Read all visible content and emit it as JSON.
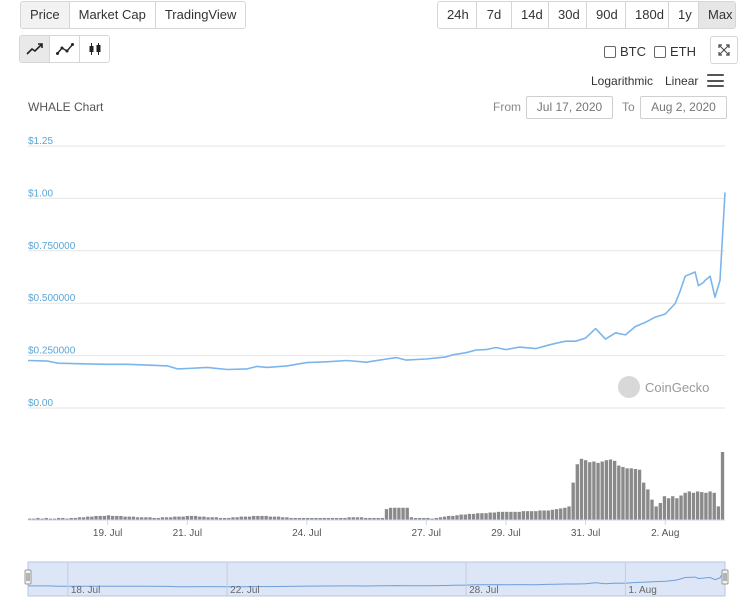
{
  "tabs": [
    "Price",
    "Market Cap",
    "TradingView"
  ],
  "active_tab": 0,
  "ranges": [
    "24h",
    "7d",
    "14d",
    "30d",
    "90d",
    "180d",
    "1y",
    "Max"
  ],
  "active_range": 7,
  "chart_types": [
    "line-chart-icon",
    "line-markers-chart-icon",
    "candlestick-chart-icon"
  ],
  "compare": {
    "btc": "BTC",
    "eth": "ETH"
  },
  "scale": {
    "log": "Logarithmic",
    "linear": "Linear"
  },
  "chart_title": "WHALE Chart",
  "range_inputs": {
    "from_label": "From",
    "from_value": "Jul 17, 2020",
    "to_label": "To",
    "to_value": "Aug 2, 2020"
  },
  "watermark": "CoinGecko",
  "colors": {
    "price_line": "#7cb5ec",
    "volume_bar": "#8a8a8a",
    "axis_text": "#5aa6d6",
    "navigator_fill": "#cfdcf2"
  },
  "chart_data": {
    "type": "line",
    "y_ticks": [
      "$0.00",
      "$0.250000",
      "$0.500000",
      "$0.750000",
      "$1.00",
      "$1.25"
    ],
    "ylim": [
      0,
      1.25
    ],
    "x_ticks": [
      "19. Jul",
      "21. Jul",
      "24. Jul",
      "27. Jul",
      "29. Jul",
      "31. Jul",
      "2. Aug"
    ],
    "navigator_ticks": [
      "18. Jul",
      "22. Jul",
      "28. Jul",
      "1. Aug"
    ],
    "price": [
      [
        "2020-07-17 00:00",
        0.198
      ],
      [
        "2020-07-17 12:00",
        0.195
      ],
      [
        "2020-07-17 18:00",
        0.185
      ],
      [
        "2020-07-18 12:00",
        0.182
      ],
      [
        "2020-07-19 00:00",
        0.18
      ],
      [
        "2020-07-19 12:00",
        0.18
      ],
      [
        "2020-07-20 00:00",
        0.176
      ],
      [
        "2020-07-20 12:00",
        0.172
      ],
      [
        "2020-07-20 18:00",
        0.158
      ],
      [
        "2020-07-21 00:00",
        0.16
      ],
      [
        "2020-07-21 12:00",
        0.165
      ],
      [
        "2020-07-22 00:00",
        0.155
      ],
      [
        "2020-07-22 12:00",
        0.158
      ],
      [
        "2020-07-22 18:00",
        0.17
      ],
      [
        "2020-07-23 00:00",
        0.165
      ],
      [
        "2020-07-23 12:00",
        0.172
      ],
      [
        "2020-07-24 00:00",
        0.188
      ],
      [
        "2020-07-24 12:00",
        0.192
      ],
      [
        "2020-07-25 00:00",
        0.198
      ],
      [
        "2020-07-25 12:00",
        0.19
      ],
      [
        "2020-07-26 00:00",
        0.205
      ],
      [
        "2020-07-26 06:00",
        0.212
      ],
      [
        "2020-07-26 12:00",
        0.2
      ],
      [
        "2020-07-27 00:00",
        0.205
      ],
      [
        "2020-07-27 12:00",
        0.215
      ],
      [
        "2020-07-27 16:00",
        0.225
      ],
      [
        "2020-07-28 00:00",
        0.235
      ],
      [
        "2020-07-28 06:00",
        0.248
      ],
      [
        "2020-07-28 12:00",
        0.25
      ],
      [
        "2020-07-28 18:00",
        0.26
      ],
      [
        "2020-07-29 00:00",
        0.25
      ],
      [
        "2020-07-29 08:00",
        0.262
      ],
      [
        "2020-07-29 18:00",
        0.255
      ],
      [
        "2020-07-30 00:00",
        0.268
      ],
      [
        "2020-07-30 06:00",
        0.28
      ],
      [
        "2020-07-30 12:00",
        0.29
      ],
      [
        "2020-07-30 18:00",
        0.29
      ],
      [
        "2020-07-31 00:00",
        0.305
      ],
      [
        "2020-07-31 06:00",
        0.35
      ],
      [
        "2020-07-31 12:00",
        0.3
      ],
      [
        "2020-07-31 18:00",
        0.33
      ],
      [
        "2020-08-01 00:00",
        0.32
      ],
      [
        "2020-08-01 06:00",
        0.36
      ],
      [
        "2020-08-01 12:00",
        0.38
      ],
      [
        "2020-08-01 18:00",
        0.405
      ],
      [
        "2020-08-02 00:00",
        0.42
      ],
      [
        "2020-08-02 06:00",
        0.47
      ],
      [
        "2020-08-02 09:00",
        0.53
      ],
      [
        "2020-08-02 12:00",
        0.6
      ],
      [
        "2020-08-02 18:00",
        0.62
      ],
      [
        "2020-08-02 20:00",
        0.555
      ],
      [
        "2020-08-02 23:00",
        0.57
      ],
      [
        "2020-08-03 00:00",
        0.58
      ],
      [
        "2020-08-03 03:00",
        0.6
      ],
      [
        "2020-08-03 06:00",
        0.5
      ],
      [
        "2020-08-03 09:00",
        0.58
      ],
      [
        "2020-08-03 12:00",
        1.0
      ]
    ],
    "volume": [
      2,
      2,
      3,
      2,
      3,
      2,
      2,
      3,
      3,
      2,
      3,
      3,
      4,
      4,
      5,
      5,
      6,
      6,
      6,
      7,
      6,
      6,
      6,
      5,
      5,
      5,
      4,
      4,
      4,
      4,
      3,
      3,
      4,
      4,
      4,
      5,
      5,
      5,
      6,
      6,
      6,
      5,
      5,
      4,
      4,
      4,
      3,
      3,
      3,
      4,
      4,
      5,
      5,
      5,
      6,
      6,
      6,
      6,
      5,
      5,
      5,
      4,
      4,
      3,
      3,
      3,
      3,
      3,
      3,
      3,
      3,
      3,
      3,
      3,
      3,
      3,
      3,
      4,
      4,
      4,
      4,
      3,
      3,
      3,
      3,
      3,
      16,
      18,
      18,
      18,
      18,
      18,
      4,
      3,
      3,
      3,
      3,
      2,
      3,
      4,
      5,
      6,
      6,
      7,
      8,
      8,
      9,
      9,
      10,
      10,
      10,
      11,
      11,
      12,
      12,
      12,
      12,
      12,
      12,
      13,
      13,
      13,
      13,
      14,
      14,
      14,
      15,
      16,
      17,
      18,
      20,
      55,
      82,
      90,
      88,
      85,
      86,
      84,
      86,
      88,
      89,
      87,
      80,
      78,
      76,
      76,
      75,
      74,
      55,
      45,
      30,
      20,
      25,
      35,
      32,
      35,
      32,
      36,
      40,
      42,
      40,
      42,
      41,
      40,
      42,
      40,
      20,
      100
    ]
  }
}
